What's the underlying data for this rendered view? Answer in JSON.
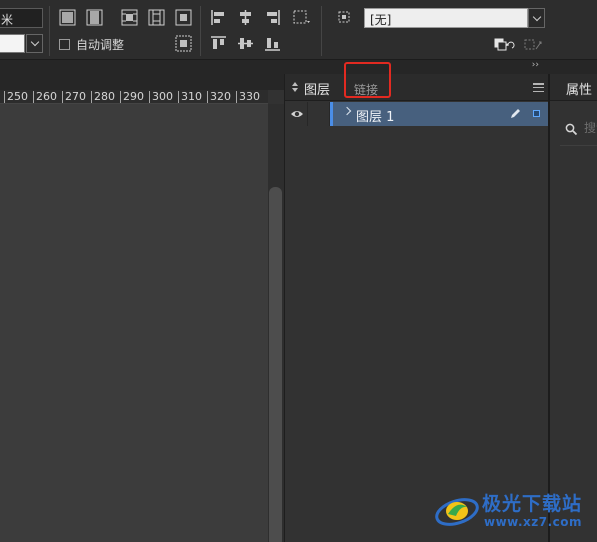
{
  "toolbar": {
    "unit_value": "米",
    "autofit_label": "自动调整",
    "autofit_checked": false,
    "object_style_value": "[无]",
    "fill_swatch_color": "#f4f4f4"
  },
  "ruler": {
    "ticks": [
      "250",
      "260",
      "270",
      "280",
      "290",
      "300",
      "310",
      "320",
      "330"
    ]
  },
  "panel_collapse_glyph": "››",
  "layers_panel": {
    "tabs": [
      {
        "label": "图层",
        "active": true
      },
      {
        "label": "链接",
        "active": false,
        "highlighted": true
      }
    ],
    "layers": [
      {
        "name": "图层 1",
        "visible": true,
        "selected": true,
        "color": "#4a8ee8"
      }
    ]
  },
  "properties_panel": {
    "tab_label": "属性",
    "search_placeholder": "搜索"
  },
  "watermark": {
    "brand": "极光下载站",
    "url": "www.xz7.com"
  },
  "colors": {
    "accent": "#4a8ee8",
    "highlight_box": "#e22a21",
    "selected_row": "#47607e"
  }
}
